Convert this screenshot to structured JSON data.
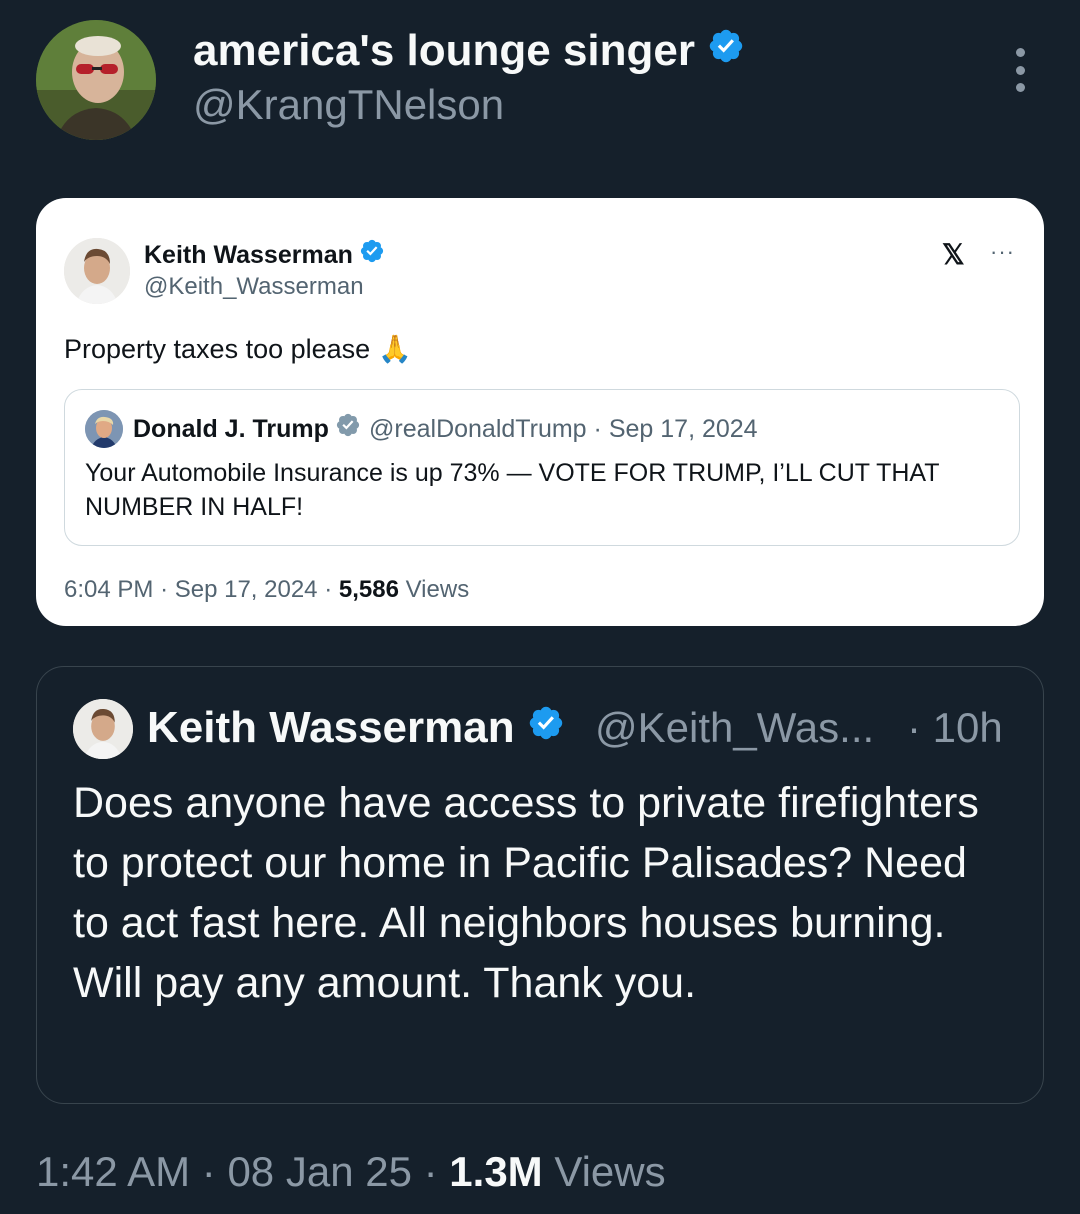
{
  "author": {
    "name": "america's lounge singer",
    "handle": "@KrangTNelson"
  },
  "screenshot": {
    "name": "Keith Wasserman",
    "handle": "@Keith_Wasserman",
    "x_logo": "𝕏",
    "more": "···",
    "text": "Property taxes too please",
    "emoji": "🙏",
    "quote": {
      "name": "Donald J. Trump",
      "handle": "@realDonaldTrump",
      "separator": "·",
      "date": "Sep 17, 2024",
      "text": "Your Automobile Insurance is up 73% — VOTE FOR TRUMP, I’LL CUT THAT NUMBER IN HALF!"
    },
    "footer": {
      "time": "6:04 PM",
      "date": "Sep 17, 2024",
      "views_count": "5,586",
      "views_label": "Views",
      "separator": "·"
    }
  },
  "quoted_tweet": {
    "name": "Keith Wasserman",
    "handle": "@Keith_Was...",
    "time": "· 10h",
    "text": "Does anyone have access to private firefighters to protect our home in Pacific Palisades? Need to act fast here. All neighbors houses burning. Will pay any amount. Thank you."
  },
  "footer": {
    "time": "1:42 AM",
    "separator": "·",
    "date": "08 Jan 25",
    "views_count": "1.3M",
    "views_label": "Views"
  },
  "colors": {
    "background": "#15202b",
    "verified": "#1d9bf0",
    "secondary_text": "#8b98a5"
  },
  "icons": [
    "verified-badge-icon",
    "more-options-icon",
    "x-logo-icon",
    "folded-hands-emoji"
  ]
}
